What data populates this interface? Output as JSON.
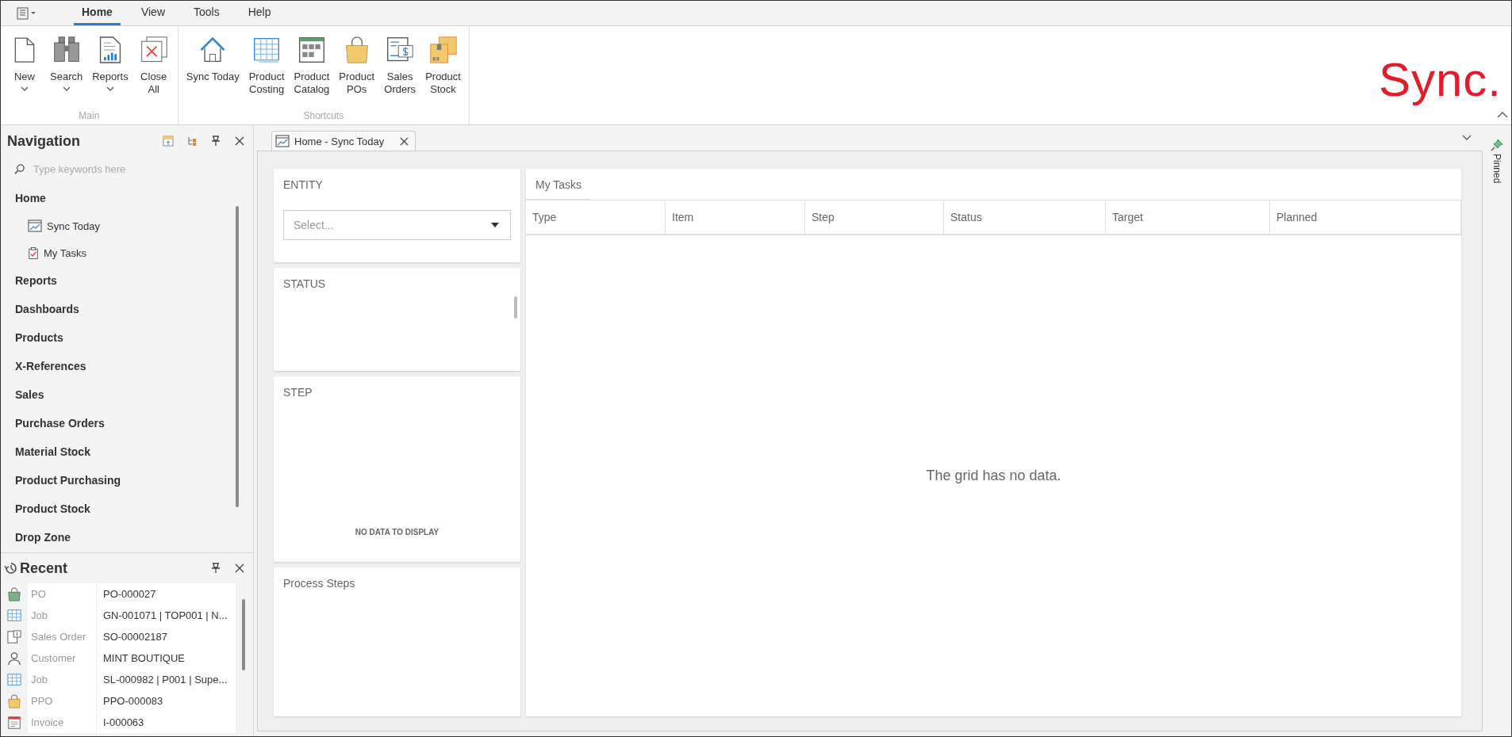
{
  "menu_tabs": [
    {
      "label": "Home",
      "selected": true
    },
    {
      "label": "View",
      "selected": false
    },
    {
      "label": "Tools",
      "selected": false
    },
    {
      "label": "Help",
      "selected": false
    }
  ],
  "ribbon": {
    "groups": [
      {
        "label": "Main",
        "buttons": [
          {
            "label": "New",
            "kind": "new",
            "dropdown": true
          },
          {
            "label": "Search",
            "kind": "search",
            "dropdown": true
          },
          {
            "label": "Reports",
            "kind": "reports",
            "dropdown": true
          },
          {
            "label": "Close\nAll",
            "kind": "close-all",
            "dropdown": false
          }
        ]
      },
      {
        "label": "Shortcuts",
        "buttons": [
          {
            "label": "Sync Today",
            "kind": "home",
            "dropdown": false
          },
          {
            "label": "Product\nCosting",
            "kind": "grid",
            "dropdown": false
          },
          {
            "label": "Product\nCatalog",
            "kind": "catalog",
            "dropdown": false
          },
          {
            "label": "Product\nPOs",
            "kind": "bag",
            "dropdown": false
          },
          {
            "label": "Sales\nOrders",
            "kind": "sales",
            "dropdown": false
          },
          {
            "label": "Product\nStock",
            "kind": "stock",
            "dropdown": false
          }
        ]
      }
    ]
  },
  "logo": "Sync.",
  "navigation": {
    "title": "Navigation",
    "search_placeholder": "Type keywords here",
    "items": [
      {
        "label": "Home",
        "children": [
          {
            "label": "Sync Today",
            "kind": "chart"
          },
          {
            "label": "My Tasks",
            "kind": "clipboard"
          }
        ]
      },
      {
        "label": "Reports"
      },
      {
        "label": "Dashboards"
      },
      {
        "label": "Products"
      },
      {
        "label": "X-References"
      },
      {
        "label": "Sales"
      },
      {
        "label": "Purchase Orders"
      },
      {
        "label": "Material Stock"
      },
      {
        "label": "Product Purchasing"
      },
      {
        "label": "Product Stock"
      },
      {
        "label": "Drop Zone"
      }
    ]
  },
  "recent": {
    "title": "Recent",
    "rows": [
      {
        "kind": "bag-green",
        "type": "PO",
        "value": "PO-000027"
      },
      {
        "kind": "grid",
        "type": "Job",
        "value": "GN-001071 | TOP001 | N..."
      },
      {
        "kind": "sales",
        "type": "Sales Order",
        "value": "SO-00002187"
      },
      {
        "kind": "person",
        "type": "Customer",
        "value": "MINT BOUTIQUE"
      },
      {
        "kind": "grid",
        "type": "Job",
        "value": "SL-000982 | P001 | Supe..."
      },
      {
        "kind": "bag",
        "type": "PPO",
        "value": "PPO-000083"
      },
      {
        "kind": "invoice",
        "type": "Invoice",
        "value": "I-000063"
      }
    ]
  },
  "document_tab": {
    "label": "Home - Sync Today"
  },
  "filters": [
    {
      "title": "ENTITY",
      "placeholder": "Select..."
    },
    {
      "title": "STATUS"
    },
    {
      "title": "STEP",
      "empty_text": "NO DATA TO DISPLAY"
    },
    {
      "title": "Process Steps"
    }
  ],
  "tasks": {
    "title": "My Tasks",
    "columns": [
      "Type",
      "Item",
      "Step",
      "Status",
      "Target",
      "Planned"
    ],
    "empty_text": "The grid has no data."
  },
  "pinned_label": "Pinned"
}
